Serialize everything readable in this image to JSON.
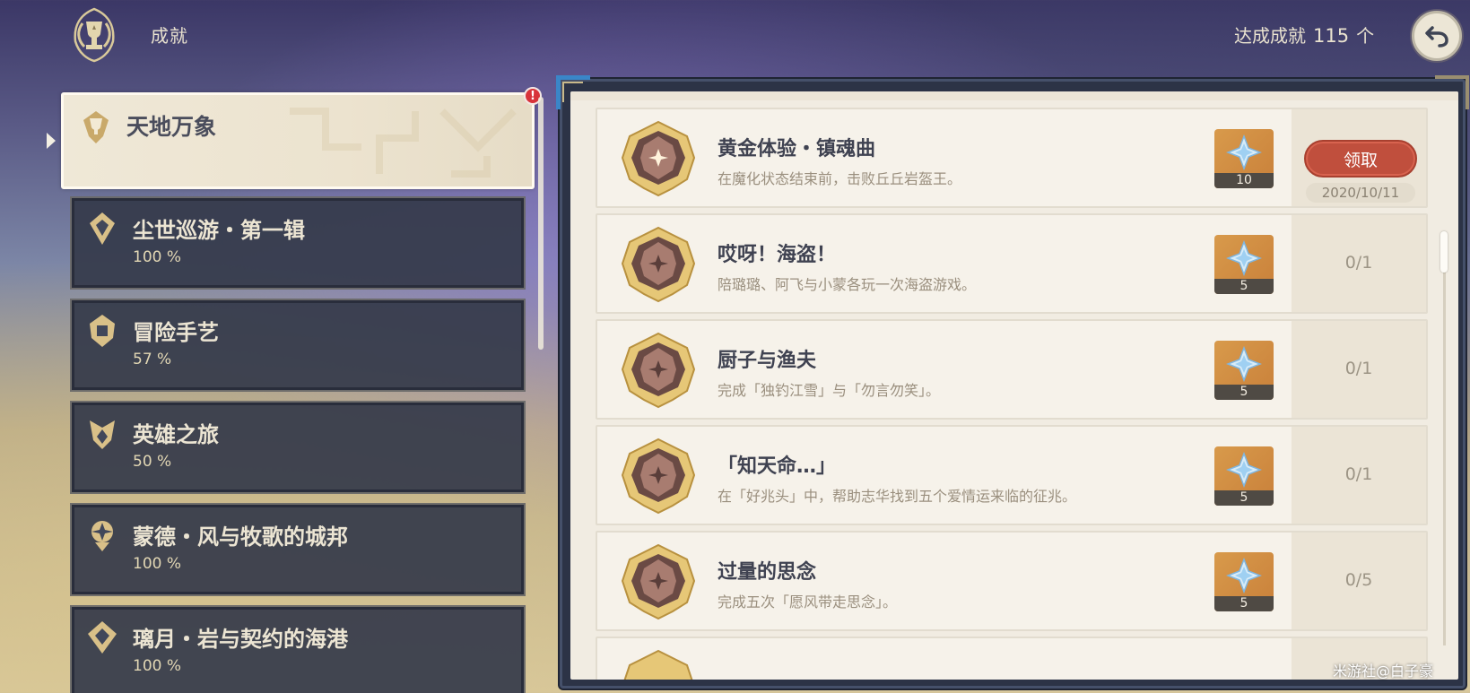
{
  "header": {
    "title": "成就",
    "count_label": "达成成就",
    "count_value": "115",
    "count_unit": "个",
    "back_icon": "back-arrow-icon",
    "emblem_icon": "trophy-emblem-icon"
  },
  "sidebar": {
    "active": {
      "name": "天地万象",
      "badge": "!"
    },
    "items": [
      {
        "name": "尘世巡游・第一辑",
        "percent": "100 %"
      },
      {
        "name": "冒险手艺",
        "percent": "57 %"
      },
      {
        "name": "英雄之旅",
        "percent": "50 %"
      },
      {
        "name": "蒙德・风与牧歌的城邦",
        "percent": "100 %"
      },
      {
        "name": "璃月・岩与契约的海港",
        "percent": "100 %"
      }
    ]
  },
  "achievements": [
    {
      "title": "黄金体验・镇魂曲",
      "desc": "在魔化状态结束前，击败丘丘岩盔王。",
      "reward_qty": "10",
      "claim_label": "领取",
      "date": "2020/10/11"
    },
    {
      "title": "哎呀！海盗！",
      "desc": "陪璐璐、阿飞与小蒙各玩一次海盗游戏。",
      "reward_qty": "5",
      "progress": "0/1"
    },
    {
      "title": "厨子与渔夫",
      "desc": "完成「独钓江雪」与「勿言勿笑」。",
      "reward_qty": "5",
      "progress": "0/1"
    },
    {
      "title": "「知天命…」",
      "desc": "在「好兆头」中，帮助志华找到五个爱情运来临的征兆。",
      "reward_qty": "5",
      "progress": "0/1"
    },
    {
      "title": "过量的思念",
      "desc": "完成五次「愿风带走思念」。",
      "reward_qty": "5",
      "progress": "0/5"
    }
  ],
  "reward_icon": "primogem-icon",
  "watermark": "米游社@白子豪",
  "colors": {
    "claim_button": "#c04f3d",
    "reward_bg": "#d89a4b",
    "panel_bg": "#f1ece2",
    "sidebar_item_bg": "#343a4a"
  }
}
